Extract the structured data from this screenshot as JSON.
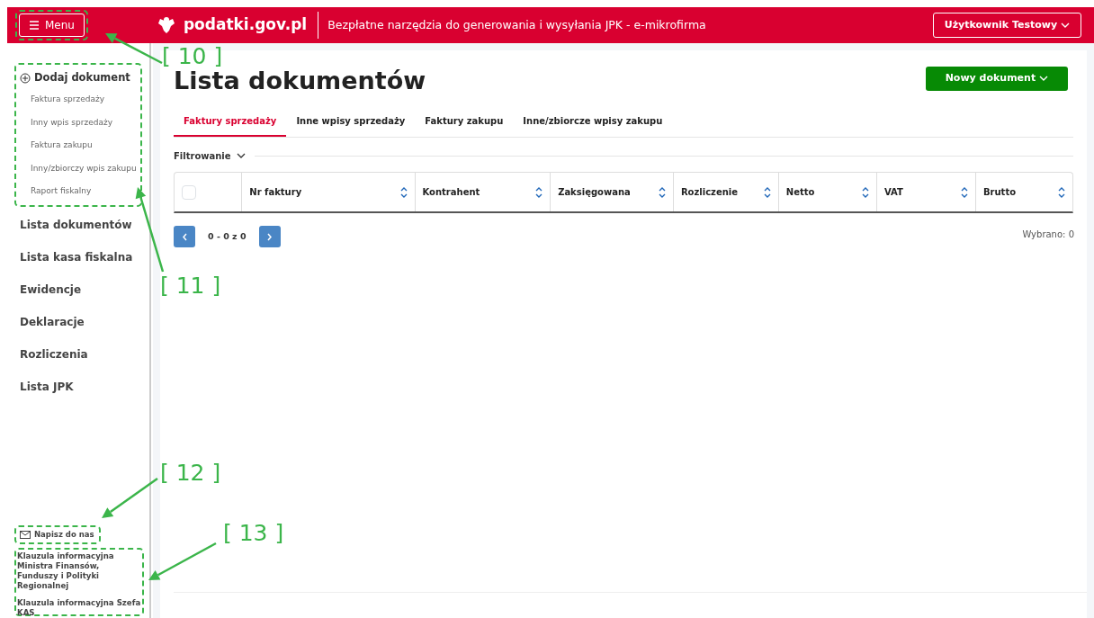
{
  "header": {
    "menu_label": "Menu",
    "logo_text": "podatki.gov.pl",
    "tagline": "Bezpłatne narzędzia do generowania i wysyłania JPK - e-mikrofirma",
    "user": "Użytkownik Testowy"
  },
  "sidebar": {
    "add_document": {
      "label": "Dodaj dokument",
      "items": [
        "Faktura sprzedaży",
        "Inny wpis sprzedaży",
        "Faktura zakupu",
        "Inny/zbiorczy wpis zakupu",
        "Raport fiskalny"
      ]
    },
    "nav": [
      "Lista dokumentów",
      "Lista kasa fiskalna",
      "Ewidencje",
      "Deklaracje",
      "Rozliczenia",
      "Lista JPK"
    ],
    "contact": "Napisz do nas",
    "clauses": [
      "Klauzula informacyjna Ministra Finansów, Funduszy i Polityki Regionalnej",
      "Klauzula informacyjna Szefa KAS"
    ]
  },
  "main": {
    "title": "Lista dokumentów",
    "new_button": "Nowy dokument",
    "tabs": [
      {
        "label": "Faktury sprzedaży",
        "selected": true
      },
      {
        "label": "Inne wpisy sprzedaży",
        "selected": false
      },
      {
        "label": "Faktury zakupu",
        "selected": false
      },
      {
        "label": "Inne/zbiorcze wpisy zakupu",
        "selected": false
      }
    ],
    "filter_label": "Filtrowanie",
    "table": {
      "select_all_checked": false,
      "columns": [
        "Nr faktury",
        "Kontrahent",
        "Zaksięgowana",
        "Rozliczenie",
        "Netto",
        "VAT",
        "Brutto"
      ]
    },
    "pagination": {
      "range": "0 - 0 z 0"
    },
    "selected_count": "Wybrano: 0"
  },
  "annotations": [
    {
      "label": "[ 10 ]"
    },
    {
      "label": "[ 11 ]"
    },
    {
      "label": "[ 12 ]"
    },
    {
      "label": "[ 13 ]"
    }
  ]
}
